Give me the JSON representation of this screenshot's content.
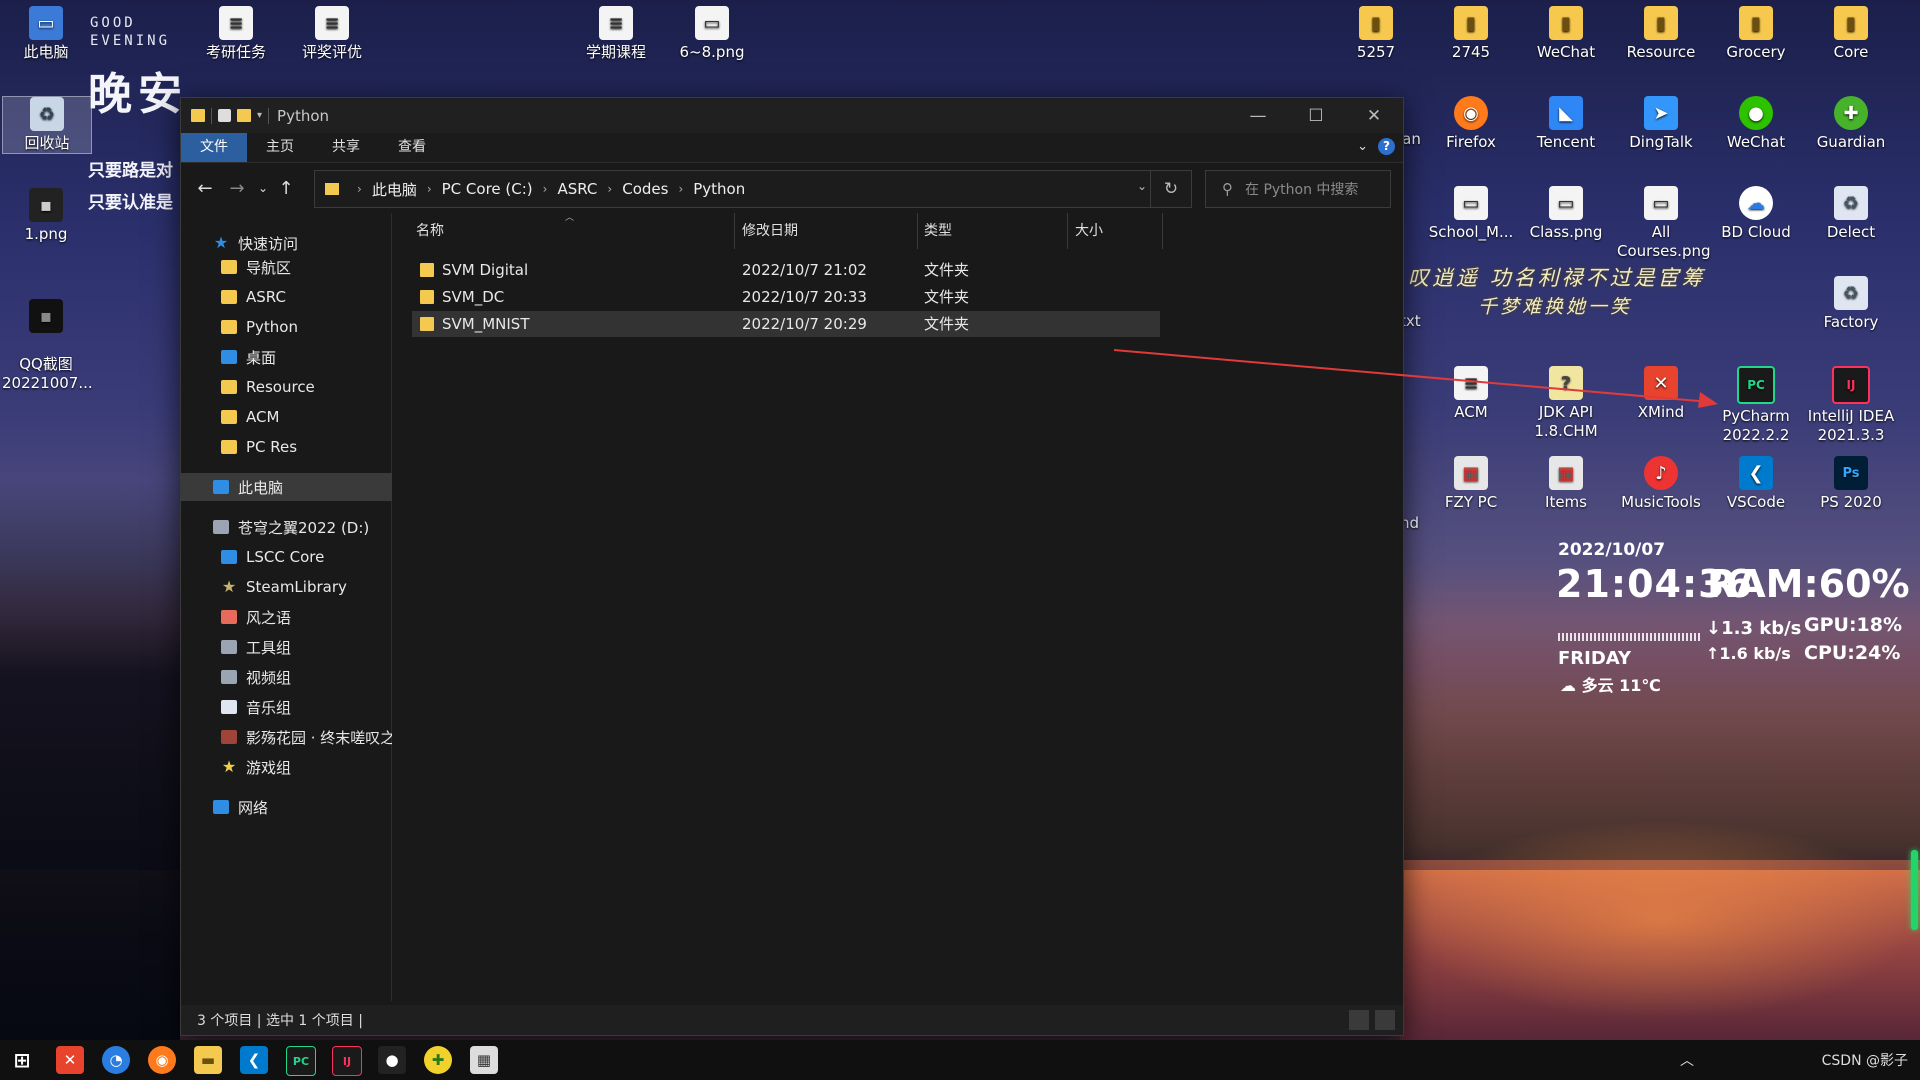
{
  "desktop": {
    "greeting": {
      "line1": "GOOD",
      "line2": "EVENING",
      "big": "晚安"
    },
    "side_text": [
      "只要路是对",
      "只要认准是"
    ],
    "left_icons": [
      {
        "label": "此电脑",
        "icon": "computer-icon"
      },
      {
        "label": "回收站",
        "icon": "recycle-bin-icon"
      },
      {
        "label": "1.png",
        "icon": "image-file-icon"
      },
      {
        "label": "QQ截图\n20221007...",
        "icon": "image-file-icon"
      }
    ],
    "top_icons": [
      {
        "label": "考研任务",
        "icon": "document-icon"
      },
      {
        "label": "评奖评优",
        "icon": "document-icon"
      },
      {
        "label": "学期课程",
        "icon": "document-icon"
      },
      {
        "label": "6~8.png",
        "icon": "image-file-icon"
      }
    ],
    "right_icons": [
      {
        "label": "5257"
      },
      {
        "label": "2745"
      },
      {
        "label": "WeChat"
      },
      {
        "label": "Resource"
      },
      {
        "label": "Grocery"
      },
      {
        "label": "Core"
      },
      {
        "label": "Firefox"
      },
      {
        "label": "Tencent"
      },
      {
        "label": "DingTalk"
      },
      {
        "label": "WeChat"
      },
      {
        "label": "Guardian"
      },
      {
        "label": "School_M..."
      },
      {
        "label": "Class.png"
      },
      {
        "label": "All\nCourses.png"
      },
      {
        "label": "BD Cloud"
      },
      {
        "label": "Delect"
      },
      {
        "label": "Factory"
      },
      {
        "label": "ACM"
      },
      {
        "label": "JDK API\n1.8.CHM"
      },
      {
        "label": "XMind"
      },
      {
        "label": "PyCharm\n2022.2.2"
      },
      {
        "label": "IntelliJ IDEA\n2021.3.3"
      },
      {
        "label": "FZY PC"
      },
      {
        "label": "Items"
      },
      {
        "label": "MusicTools"
      },
      {
        "label": "VSCode"
      },
      {
        "label": "PS 2020"
      }
    ],
    "partial_labels": [
      "ian",
      "txt",
      "nd"
    ],
    "poem": {
      "line1": "叹逍遥 功名利禄不过是宦筹",
      "line2": "千梦难换她一笑"
    }
  },
  "widget": {
    "date": "2022/10/07",
    "time": "21:04:36",
    "ram": "RAM:60%",
    "day": "FRIDAY",
    "weather": "多云 11℃",
    "net_down": "↓1.3 kb/s",
    "net_up": "↑1.6 kb/s",
    "gpu": "GPU:18%",
    "cpu": "CPU:24%"
  },
  "explorer": {
    "title": "Python",
    "ribbon_tabs": [
      "文件",
      "主页",
      "共享",
      "查看"
    ],
    "breadcrumb": [
      "此电脑",
      "PC Core (C:)",
      "ASRC",
      "Codes",
      "Python"
    ],
    "search_placeholder": "在 Python 中搜索",
    "nav": {
      "quick_access": "快速访问",
      "quick_items": [
        "导航区",
        "ASRC",
        "Python",
        "桌面",
        "Resource",
        "ACM",
        "PC Res"
      ],
      "this_pc": "此电脑",
      "drive": "苍穹之翼2022 (D:)",
      "drive_items": [
        "LSCC Core",
        "SteamLibrary",
        "风之语",
        "工具组",
        "视频组",
        "音乐组",
        "影殇花园 · 终末嗟叹之",
        "游戏组"
      ],
      "network": "网络"
    },
    "columns": {
      "name": "名称",
      "modified": "修改日期",
      "type": "类型",
      "size": "大小"
    },
    "files": [
      {
        "name": "SVM Digital",
        "modified": "2022/10/7 21:02",
        "type": "文件夹"
      },
      {
        "name": "SVM_DC",
        "modified": "2022/10/7 20:33",
        "type": "文件夹"
      },
      {
        "name": "SVM_MNIST",
        "modified": "2022/10/7 20:29",
        "type": "文件夹"
      }
    ],
    "status": "3 个项目  |  选中 1 个项目  |"
  },
  "taskbar": {
    "tray_text": "CSDN @影子"
  },
  "colors": {
    "accent": "#2b5fa0",
    "folder": "#f3c94f",
    "annotation_arrow": "#e03a3a"
  }
}
